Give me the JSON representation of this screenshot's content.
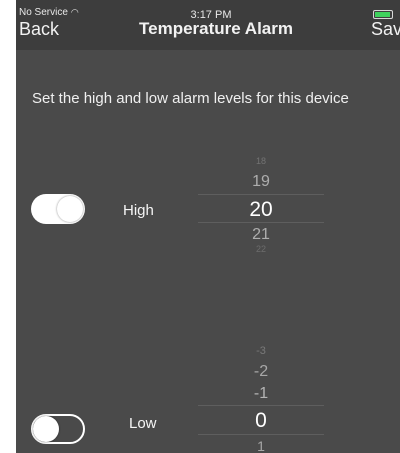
{
  "status_bar": {
    "carrier": "No Service",
    "time": "3:17 PM"
  },
  "nav": {
    "back": "Back",
    "title": "Temperature Alarm",
    "save": "Save"
  },
  "instructions": "Set the high and low alarm levels for this device",
  "high": {
    "label": "High",
    "toggle_on": true,
    "picker": {
      "above2": "18",
      "above": "19",
      "selected": "20",
      "below": "21",
      "below2": "22"
    }
  },
  "low": {
    "label": "Low",
    "toggle_on": false,
    "picker": {
      "above3": "-3",
      "above2": "-2",
      "above": "-1",
      "selected": "0",
      "below": "1"
    }
  },
  "colors": {
    "background": "#4a4a4a",
    "navbar": "#3d3d3d",
    "battery": "#3fd25d",
    "text": "#ffffff"
  }
}
